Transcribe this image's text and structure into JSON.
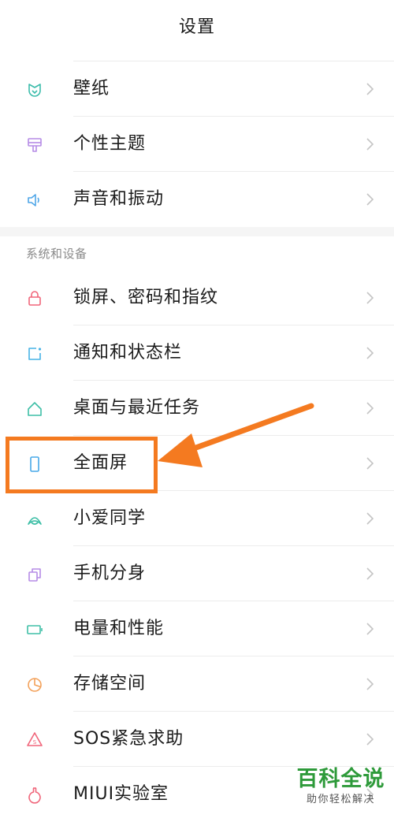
{
  "header": {
    "title": "设置"
  },
  "personalization": [
    {
      "label": "壁纸",
      "icon": "wallpaper-icon",
      "color": "#3cbcab"
    },
    {
      "label": "个性主题",
      "icon": "theme-brush-icon",
      "color": "#b58be6"
    },
    {
      "label": "声音和振动",
      "icon": "speaker-icon",
      "color": "#4fa6e8"
    }
  ],
  "section": {
    "title": "系统和设备"
  },
  "system": [
    {
      "label": "锁屏、密码和指纹",
      "icon": "lock-icon",
      "color": "#f0657a"
    },
    {
      "label": "通知和状态栏",
      "icon": "notification-icon",
      "color": "#47b3e6"
    },
    {
      "label": "桌面与最近任务",
      "icon": "home-icon",
      "color": "#3fbfa7"
    },
    {
      "label": "全面屏",
      "icon": "phone-screen-icon",
      "color": "#47a8e8"
    },
    {
      "label": "小爱同学",
      "icon": "xiaoai-icon",
      "color": "#3fbfa7"
    },
    {
      "label": "手机分身",
      "icon": "dual-space-icon",
      "color": "#b58be6"
    },
    {
      "label": "电量和性能",
      "icon": "battery-icon",
      "color": "#3fbfa7"
    },
    {
      "label": "存储空间",
      "icon": "storage-pie-icon",
      "color": "#f3a15a"
    },
    {
      "label": "SOS紧急求助",
      "icon": "sos-icon",
      "color": "#f0657a"
    },
    {
      "label": "MIUI实验室",
      "icon": "flask-icon",
      "color": "#f0657a"
    }
  ],
  "annotation": {
    "highlight_color": "#f47a20"
  },
  "watermark": {
    "main": "百科全说",
    "sub": "助你轻松解决"
  }
}
